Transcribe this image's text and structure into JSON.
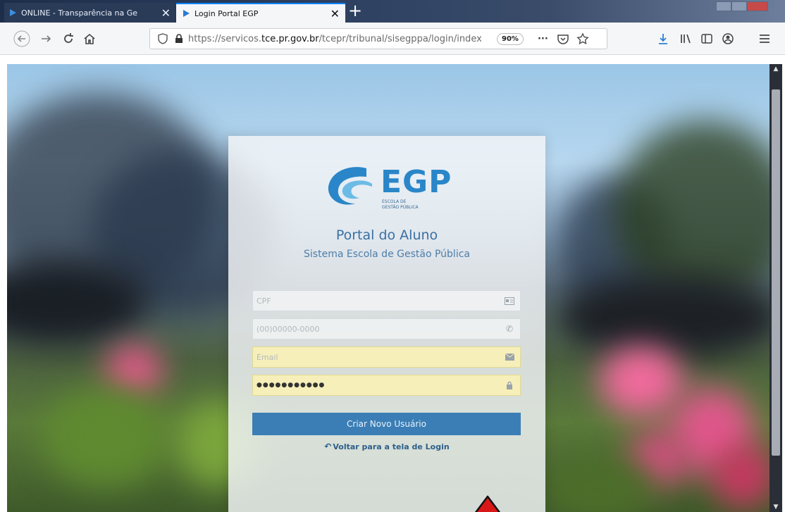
{
  "browser": {
    "tabs": [
      {
        "title": "ONLINE - Transparência na Ge",
        "active": false
      },
      {
        "title": "Login Portal EGP",
        "active": true
      }
    ],
    "url_prefix": "https://servicos.",
    "url_domain": "tce.pr.gov.br",
    "url_suffix": "/tcepr/tribunal/sisegppa/login/index",
    "zoom": "90%",
    "page_actions": "···"
  },
  "logo": {
    "text": "EGP",
    "sub_line1": "ESCOLA DE",
    "sub_line2": "GESTÃO PÚBLICA"
  },
  "portal": {
    "title": "Portal do Aluno",
    "subtitle": "Sistema Escola de Gestão Pública"
  },
  "form": {
    "cpf_placeholder": "CPF",
    "phone_placeholder": "(00)00000-0000",
    "email_placeholder": "Email",
    "password_value": "●●●●●●●●●●●",
    "create_button": "Criar Novo Usuário",
    "back_link": "Voltar para a tela de Login"
  },
  "colors": {
    "accent": "#3a7eb5",
    "brand": "#2a86c8",
    "autofill": "#f6efb9",
    "annotation_arrow": "#d81818"
  }
}
